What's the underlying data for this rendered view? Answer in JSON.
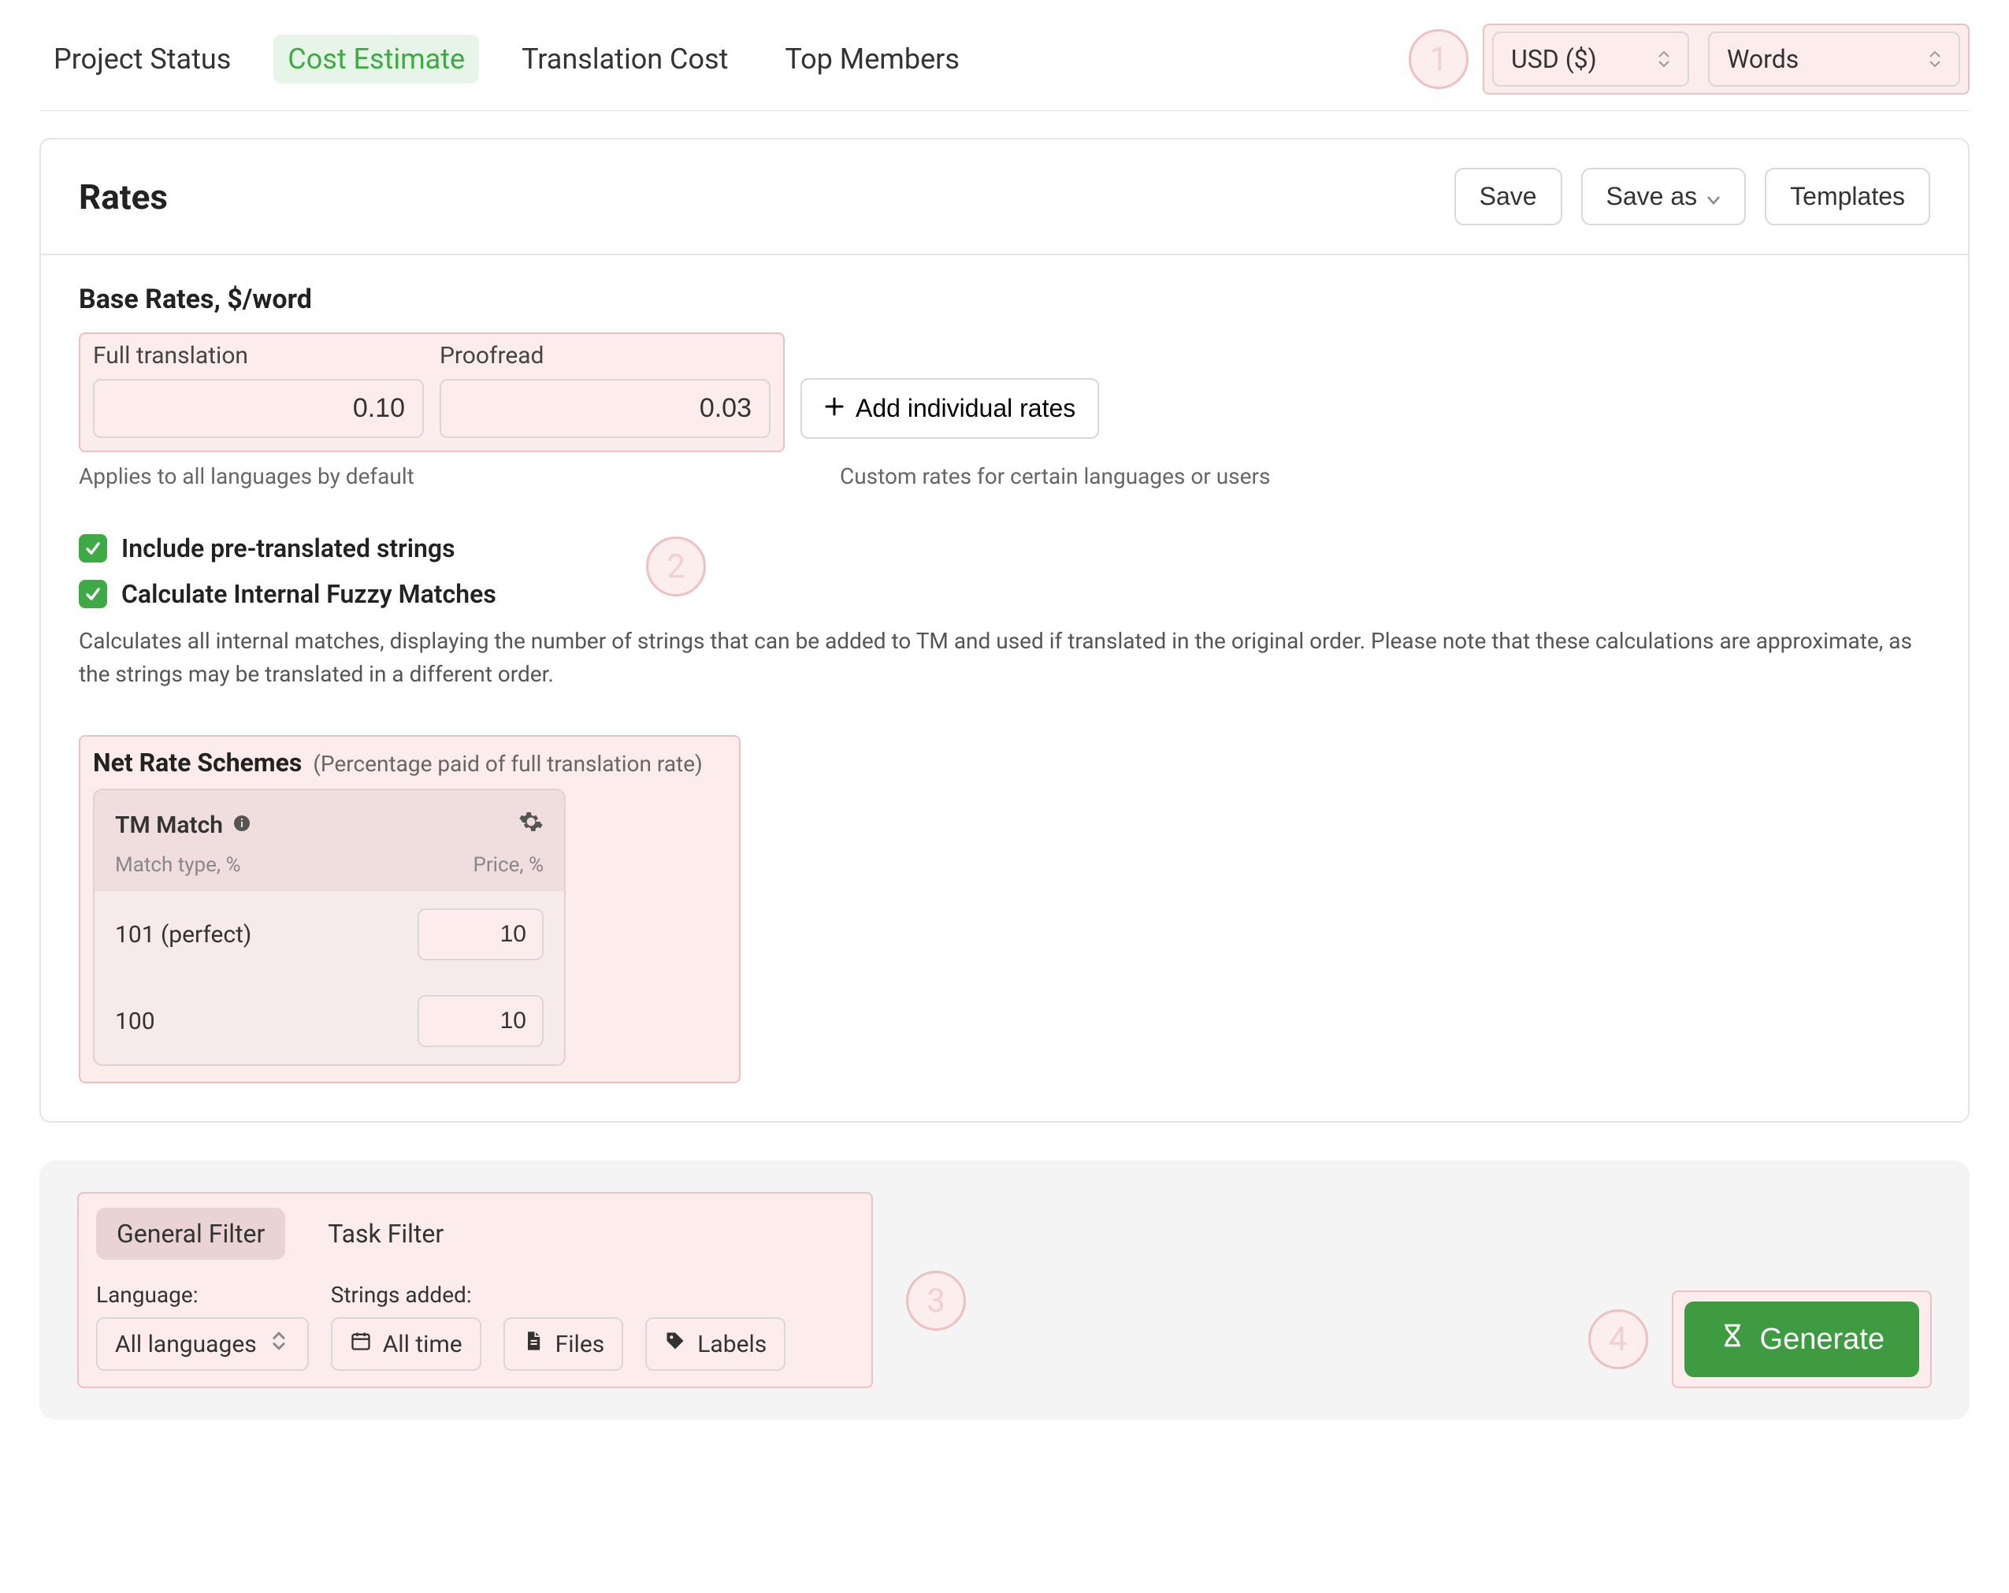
{
  "tabs": {
    "items": [
      {
        "label": "Project Status"
      },
      {
        "label": "Cost Estimate"
      },
      {
        "label": "Translation Cost"
      },
      {
        "label": "Top Members"
      }
    ]
  },
  "topSelects": {
    "currency": "USD ($)",
    "unit": "Words"
  },
  "markers": {
    "m1": "1",
    "m2": "2",
    "m3": "3",
    "m4": "4"
  },
  "rates": {
    "heading": "Rates",
    "buttons": {
      "save": "Save",
      "saveAs": "Save as",
      "templates": "Templates"
    },
    "baseTitle": "Base Rates, $/word",
    "fullLabel": "Full translation",
    "fullValue": "0.10",
    "proofLabel": "Proofread",
    "proofValue": "0.03",
    "addIndividual": "Add individual rates",
    "appliesNote": "Applies to all languages by default",
    "customNote": "Custom rates for certain languages or users",
    "check1": "Include pre-translated strings",
    "check2": "Calculate Internal Fuzzy Matches",
    "desc": "Calculates all internal matches, displaying the number of strings that can be added to TM and used if translated in the original order. Please note that these calculations are approximate, as the strings may be translated in a different order."
  },
  "nrs": {
    "title": "Net Rate Schemes",
    "sub": "(Percentage paid of full translation rate)",
    "cardTitle": "TM Match",
    "col1": "Match type, %",
    "col2": "Price, %",
    "rows": [
      {
        "label": "101 (perfect)",
        "value": "10"
      },
      {
        "label": "100",
        "value": "10"
      }
    ]
  },
  "filters": {
    "tab1": "General Filter",
    "tab2": "Task Filter",
    "languageLabel": "Language:",
    "languageValue": "All languages",
    "stringsLabel": "Strings added:",
    "allTime": "All time",
    "files": "Files",
    "labels": "Labels"
  },
  "generate": {
    "label": "Generate"
  }
}
